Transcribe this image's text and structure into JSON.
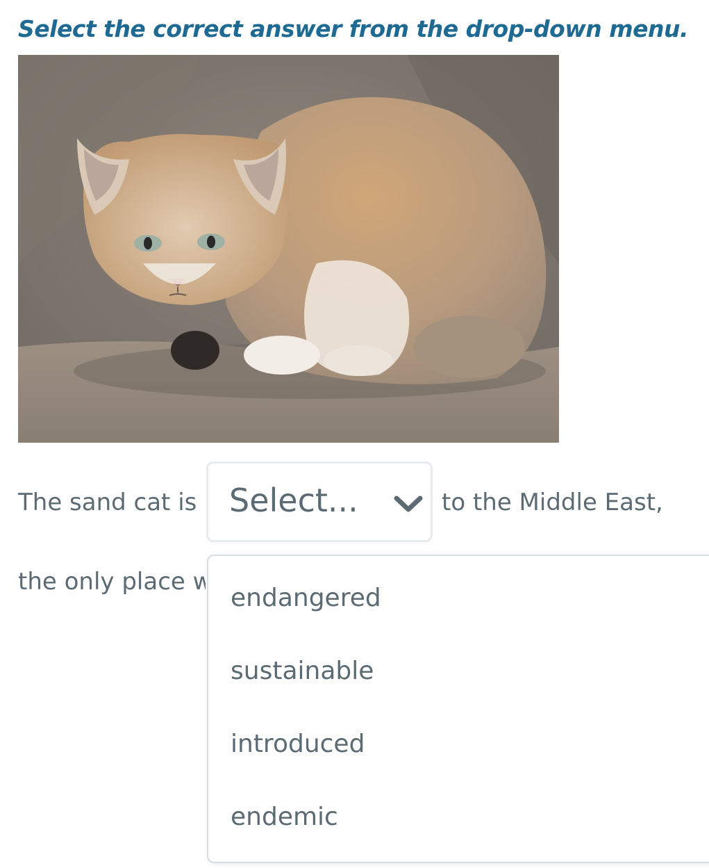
{
  "instruction": "Select the correct answer from the drop-down menu.",
  "sentence": {
    "before": "The sand cat is",
    "after": "to the Middle East,",
    "line2_visible": "the only place w"
  },
  "select": {
    "value": "Select..."
  },
  "dropdown": {
    "options": [
      "endangered",
      "sustainable",
      "introduced",
      "endemic"
    ]
  },
  "colors": {
    "instruction": "#1e6a93",
    "body_text": "#5c6b73",
    "border": "#e8ecee"
  },
  "icons": {
    "select_arrow": "chevron-down-icon"
  }
}
